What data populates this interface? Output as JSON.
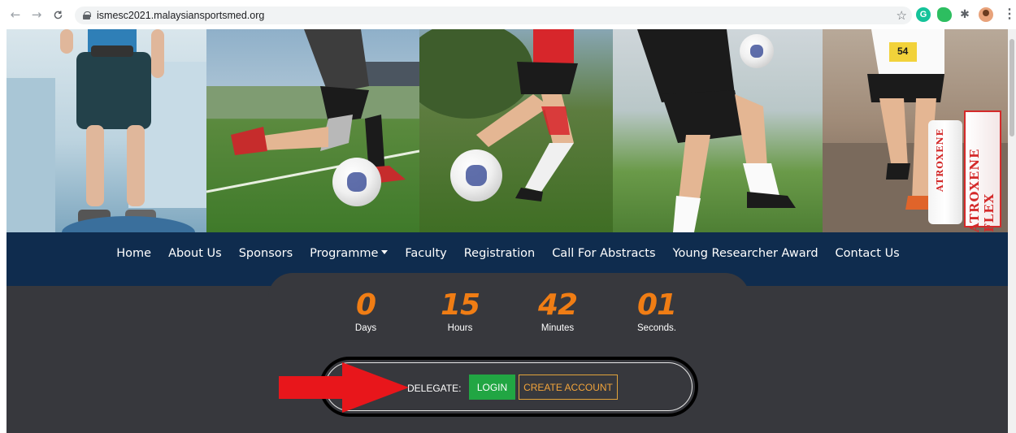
{
  "browser": {
    "url": "ismesc2021.malaysiansportsmed.org",
    "back_icon": "←",
    "forward_icon": "→",
    "reload_icon": "C",
    "bookmark_icon": "☆",
    "grammarly_icon": "G",
    "evernote_icon": "",
    "extensions_icon": "✱",
    "menu_icon": "⋮"
  },
  "hero": {
    "brand_box": "ATROXENE FLEX",
    "brand_tube": "ATROXENE",
    "bib_number": "54"
  },
  "nav": {
    "items": [
      {
        "label": "Home"
      },
      {
        "label": "About Us"
      },
      {
        "label": "Sponsors"
      },
      {
        "label": "Programme"
      },
      {
        "label": "Faculty"
      },
      {
        "label": "Registration"
      },
      {
        "label": "Call For Abstracts"
      },
      {
        "label": "Young Researcher Award"
      },
      {
        "label": "Contact Us"
      }
    ]
  },
  "countdown": {
    "days": {
      "value": "0",
      "label": "Days"
    },
    "hours": {
      "value": "15",
      "label": "Hours"
    },
    "minutes": {
      "value": "42",
      "label": "Minutes"
    },
    "seconds": {
      "value": "01",
      "label": "Seconds."
    }
  },
  "delegate": {
    "label": "DELEGATE:",
    "login": "LOGIN",
    "create_account": "CREATE ACCOUNT"
  },
  "colors": {
    "navbar": "#0f2c4e",
    "page_bg": "#37383d",
    "countdown_accent": "#f07d14",
    "login_green": "#21a643",
    "create_outline": "#e0a33c",
    "annotation_arrow": "#e8161b"
  }
}
